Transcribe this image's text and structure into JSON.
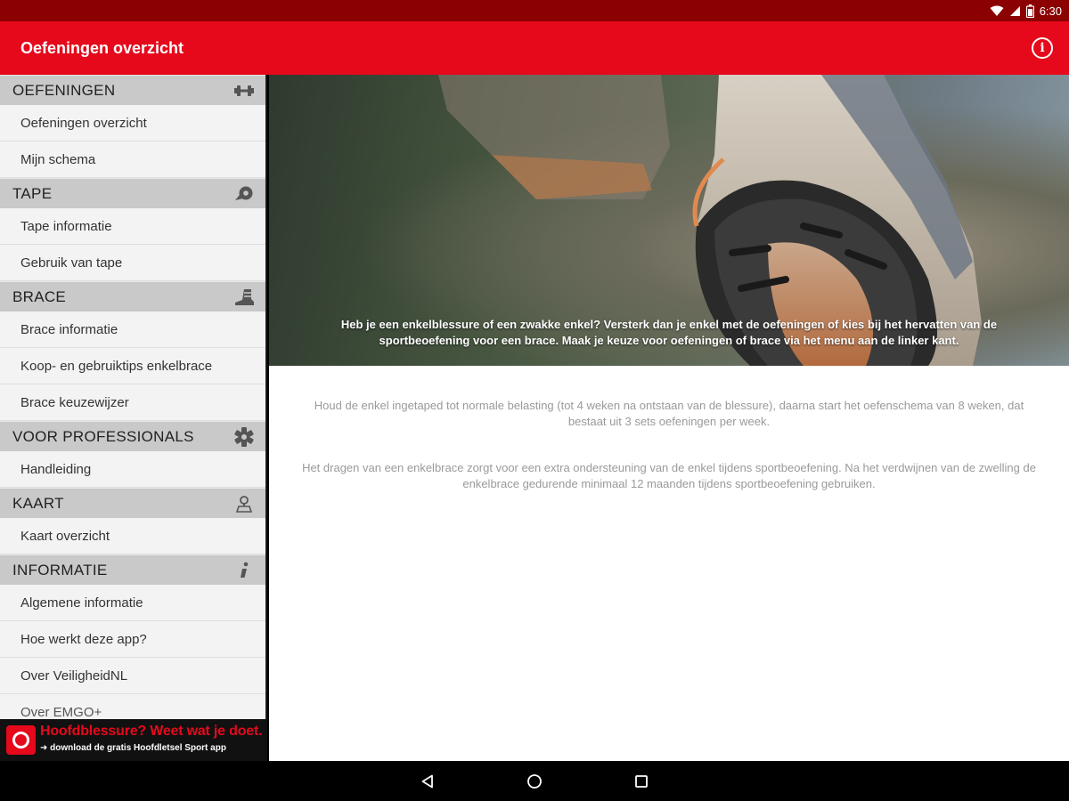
{
  "status_bar": {
    "time": "6:30",
    "icons": [
      "wifi-icon",
      "signal-icon",
      "battery-icon"
    ]
  },
  "app_bar": {
    "title": "Oefeningen overzicht",
    "action_icon": "info-icon"
  },
  "drawer": {
    "sections": [
      {
        "title": "OEFENINGEN",
        "icon": "dumbbell-icon",
        "items": [
          "Oefeningen overzicht",
          "Mijn schema"
        ]
      },
      {
        "title": "TAPE",
        "icon": "tape-roll-icon",
        "items": [
          "Tape informatie",
          "Gebruik van tape"
        ]
      },
      {
        "title": "BRACE",
        "icon": "ankle-brace-icon",
        "items": [
          "Brace informatie",
          "Koop- en gebruiktips enkelbrace",
          "Brace keuzewijzer"
        ]
      },
      {
        "title": "VOOR PROFESSIONALS",
        "icon": "medical-star-icon",
        "items": [
          "Handleiding"
        ]
      },
      {
        "title": "KAART",
        "icon": "map-pin-icon",
        "items": [
          "Kaart overzicht"
        ]
      },
      {
        "title": "INFORMATIE",
        "icon": "info-i-icon",
        "items": [
          "Algemene informatie",
          "Hoe werkt deze app?",
          "Over VeiligheidNL",
          "Over EMGO+"
        ]
      }
    ]
  },
  "ad": {
    "headline": "Hoofdblessure? Weet wat je doet.",
    "subline": "➜ download de gratis Hoofdletsel Sport app"
  },
  "hero": {
    "text": "Heb je een enkelblessure of een zwakke enkel? Versterk dan je enkel met de oefeningen of kies bij het hervatten van de sportbeoefening voor een brace. Maak je keuze voor oefeningen of brace via het menu aan de linker kant."
  },
  "content": {
    "para1": "Houd de enkel ingetaped tot normale belasting (tot 4 weken na ontstaan van de blessure), daarna start het oefenschema van 8 weken, dat bestaat uit 3 sets oefeningen per week.",
    "para2": "Het dragen van een enkelbrace zorgt voor een extra ondersteuning van de enkel tijdens sportbeoefening. Na het verdwijnen van de zwelling de enkelbrace gedurende minimaal 12 maanden tijdens sportbeoefening gebruiken."
  },
  "nav_bar": {
    "buttons": [
      "back-icon",
      "home-icon",
      "recents-icon"
    ]
  }
}
